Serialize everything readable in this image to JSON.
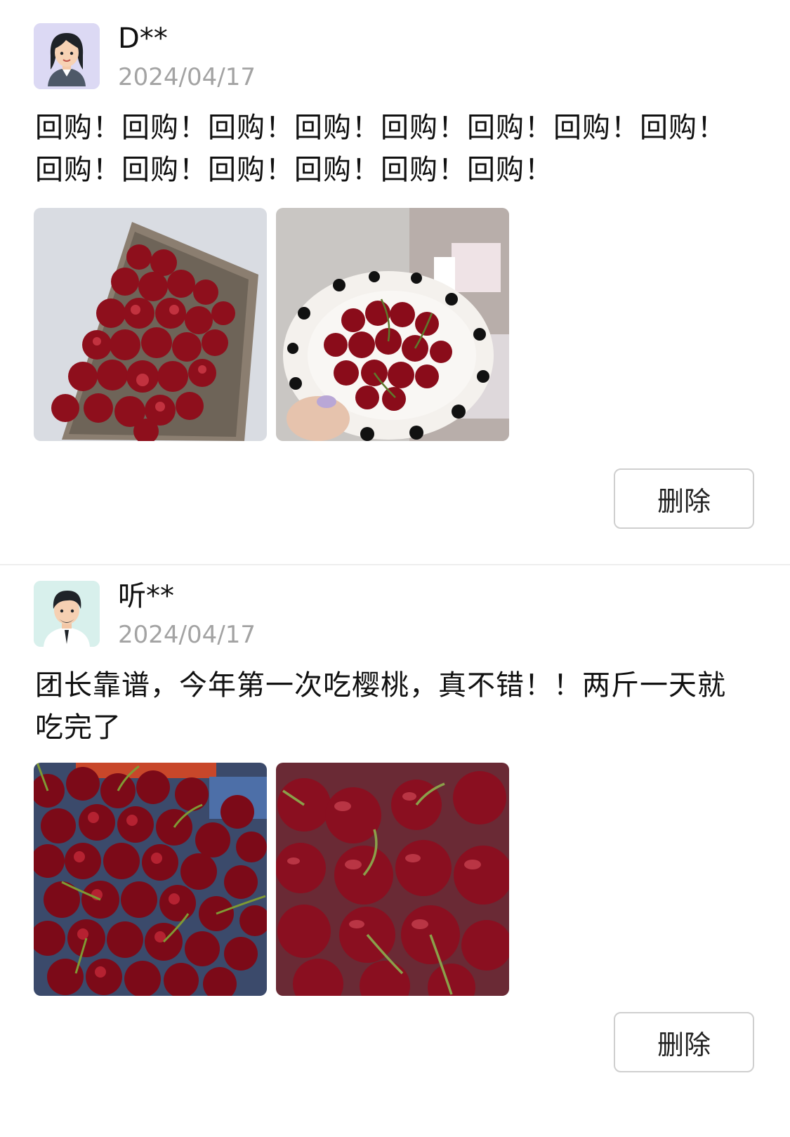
{
  "reviews": [
    {
      "username": "D**",
      "date": "2024/04/17",
      "text": "回购！回购！回购！回购！回购！回购！回购！回购！回购！回购！回购！回购！回购！回购！",
      "avatar_icon": "female-avatar-icon",
      "photos": [
        "cherries-in-tray-photo",
        "cherries-in-polka-dot-bowl-photo"
      ],
      "delete_label": "删除"
    },
    {
      "username": "听**",
      "date": "2024/04/17",
      "text": "团长靠谱，今年第一次吃樱桃，真不错！！两斤一天就吃完了",
      "avatar_icon": "male-avatar-icon",
      "photos": [
        "cherry-pile-photo",
        "cherry-closeup-photo"
      ],
      "delete_label": "删除"
    }
  ],
  "colors": {
    "date_gray": "#a3a3a3",
    "button_border": "#cfcfcf",
    "divider": "#eeeeee",
    "cherry_red": "#8e0f1c"
  }
}
